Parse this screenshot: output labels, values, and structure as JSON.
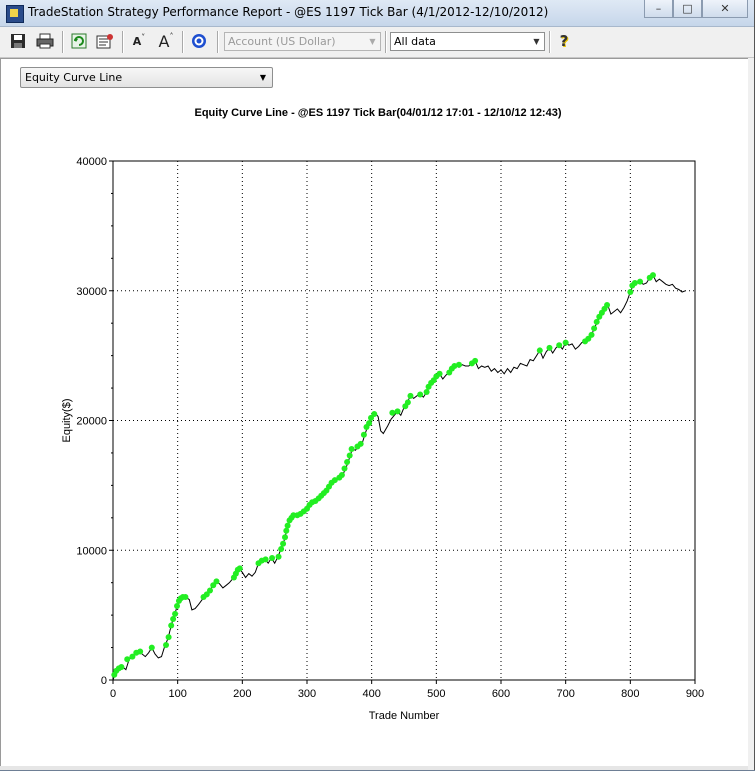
{
  "window": {
    "title": "TradeStation Strategy Performance Report - @ES 1197 Tick Bar (4/1/2012-12/10/2012)",
    "controls": {
      "minimize": "–",
      "maximize": "□",
      "close": "✕"
    }
  },
  "toolbar": {
    "icons": [
      "save-icon",
      "print-icon",
      "refresh-icon",
      "settings-icon",
      "font-decrease-icon",
      "font-increase-icon",
      "target-icon",
      "help-icon"
    ],
    "font_small": "A",
    "font_large": "A",
    "help": "?",
    "account_select": "Account (US Dollar)",
    "range_select": "All data"
  },
  "view_select": {
    "value": "Equity Curve Line"
  },
  "chart_data": {
    "type": "line",
    "title": "Equity Curve Line - @ES 1197 Tick Bar(04/01/12 17:01 - 12/10/12 12:43)",
    "xlabel": "Trade Number",
    "ylabel": "Equity($)",
    "xlim": [
      0,
      900
    ],
    "ylim": [
      0,
      40000
    ],
    "x_ticks": [
      0,
      100,
      200,
      300,
      400,
      500,
      600,
      700,
      800,
      900
    ],
    "y_ticks": [
      0,
      10000,
      20000,
      30000,
      40000
    ],
    "grid": "dotted",
    "colors": {
      "line": "#000000",
      "new_high_marker": "#22ee22"
    },
    "series": [
      {
        "points": [
          [
            0,
            0
          ],
          [
            5,
            700
          ],
          [
            10,
            900
          ],
          [
            15,
            1000
          ],
          [
            20,
            800
          ],
          [
            25,
            1600
          ],
          [
            30,
            1800
          ],
          [
            35,
            2000
          ],
          [
            40,
            2200
          ],
          [
            45,
            2000
          ],
          [
            50,
            1800
          ],
          [
            55,
            2100
          ],
          [
            60,
            2500
          ],
          [
            65,
            2000
          ],
          [
            70,
            1700
          ],
          [
            75,
            1800
          ],
          [
            80,
            2600
          ],
          [
            85,
            3200
          ],
          [
            90,
            4200
          ],
          [
            95,
            5000
          ],
          [
            100,
            5800
          ],
          [
            105,
            6300
          ],
          [
            110,
            6400
          ],
          [
            115,
            6300
          ],
          [
            118,
            6200
          ],
          [
            122,
            5400
          ],
          [
            127,
            5500
          ],
          [
            132,
            5800
          ],
          [
            138,
            6200
          ],
          [
            145,
            6600
          ],
          [
            150,
            6900
          ],
          [
            155,
            7300
          ],
          [
            160,
            7600
          ],
          [
            165,
            7400
          ],
          [
            170,
            7100
          ],
          [
            175,
            7300
          ],
          [
            180,
            7500
          ],
          [
            185,
            7800
          ],
          [
            190,
            8200
          ],
          [
            195,
            8600
          ],
          [
            200,
            8300
          ],
          [
            205,
            7900
          ],
          [
            210,
            8200
          ],
          [
            215,
            8000
          ],
          [
            220,
            8300
          ],
          [
            225,
            9000
          ],
          [
            230,
            9200
          ],
          [
            235,
            9300
          ],
          [
            240,
            9000
          ],
          [
            245,
            9400
          ],
          [
            250,
            9000
          ],
          [
            255,
            9500
          ],
          [
            260,
            10100
          ],
          [
            265,
            10800
          ],
          [
            270,
            11800
          ],
          [
            275,
            12500
          ],
          [
            280,
            12700
          ],
          [
            285,
            12600
          ],
          [
            290,
            12800
          ],
          [
            295,
            13000
          ],
          [
            300,
            13200
          ],
          [
            305,
            13600
          ],
          [
            310,
            13700
          ],
          [
            315,
            13800
          ],
          [
            320,
            14000
          ],
          [
            325,
            14300
          ],
          [
            330,
            14500
          ],
          [
            335,
            14800
          ],
          [
            340,
            15200
          ],
          [
            345,
            15400
          ],
          [
            350,
            15500
          ],
          [
            355,
            15800
          ],
          [
            360,
            16300
          ],
          [
            365,
            17000
          ],
          [
            370,
            17800
          ],
          [
            375,
            17700
          ],
          [
            380,
            18100
          ],
          [
            385,
            18200
          ],
          [
            390,
            19000
          ],
          [
            395,
            19700
          ],
          [
            400,
            20200
          ],
          [
            405,
            20600
          ],
          [
            410,
            20300
          ],
          [
            414,
            19200
          ],
          [
            418,
            19000
          ],
          [
            425,
            19600
          ],
          [
            430,
            20100
          ],
          [
            435,
            20400
          ],
          [
            440,
            20700
          ],
          [
            445,
            20400
          ],
          [
            450,
            21000
          ],
          [
            455,
            21400
          ],
          [
            460,
            21900
          ],
          [
            465,
            21700
          ],
          [
            470,
            21900
          ],
          [
            475,
            22000
          ],
          [
            480,
            21800
          ],
          [
            485,
            22200
          ],
          [
            490,
            22700
          ],
          [
            495,
            23000
          ],
          [
            500,
            23400
          ],
          [
            505,
            23600
          ],
          [
            510,
            23200
          ],
          [
            515,
            23500
          ],
          [
            520,
            23700
          ],
          [
            525,
            24100
          ],
          [
            530,
            24300
          ],
          [
            535,
            24100
          ],
          [
            540,
            24300
          ],
          [
            545,
            24200
          ],
          [
            550,
            24200
          ],
          [
            555,
            24400
          ],
          [
            560,
            24600
          ],
          [
            565,
            24000
          ],
          [
            570,
            24200
          ],
          [
            575,
            24100
          ],
          [
            580,
            24200
          ],
          [
            585,
            23800
          ],
          [
            590,
            24000
          ],
          [
            595,
            23700
          ],
          [
            600,
            23900
          ],
          [
            605,
            23600
          ],
          [
            610,
            24000
          ],
          [
            615,
            23700
          ],
          [
            620,
            24100
          ],
          [
            625,
            24000
          ],
          [
            630,
            24400
          ],
          [
            635,
            24300
          ],
          [
            640,
            24200
          ],
          [
            645,
            24700
          ],
          [
            650,
            24600
          ],
          [
            655,
            25000
          ],
          [
            660,
            25400
          ],
          [
            665,
            24800
          ],
          [
            670,
            25300
          ],
          [
            675,
            25600
          ],
          [
            680,
            25200
          ],
          [
            685,
            25600
          ],
          [
            690,
            25800
          ],
          [
            695,
            25500
          ],
          [
            700,
            26000
          ],
          [
            705,
            25800
          ],
          [
            710,
            25900
          ],
          [
            715,
            25500
          ],
          [
            720,
            25700
          ],
          [
            725,
            26000
          ],
          [
            730,
            26100
          ],
          [
            735,
            26300
          ],
          [
            740,
            26600
          ],
          [
            745,
            27200
          ],
          [
            750,
            27700
          ],
          [
            755,
            28200
          ],
          [
            760,
            28500
          ],
          [
            765,
            28900
          ],
          [
            770,
            28200
          ],
          [
            775,
            28400
          ],
          [
            780,
            28600
          ],
          [
            785,
            28300
          ],
          [
            790,
            28700
          ],
          [
            795,
            29200
          ],
          [
            800,
            29900
          ],
          [
            805,
            30500
          ],
          [
            810,
            30600
          ],
          [
            815,
            30700
          ],
          [
            820,
            30500
          ],
          [
            825,
            30600
          ],
          [
            830,
            31000
          ],
          [
            835,
            31200
          ],
          [
            840,
            30700
          ],
          [
            845,
            30900
          ],
          [
            850,
            30700
          ],
          [
            855,
            30500
          ],
          [
            860,
            30400
          ],
          [
            865,
            30500
          ],
          [
            870,
            30200
          ],
          [
            875,
            30100
          ],
          [
            880,
            29900
          ],
          [
            885,
            30000
          ]
        ],
        "highs": [
          [
            2,
            400
          ],
          [
            5,
            700
          ],
          [
            9,
            900
          ],
          [
            13,
            1000
          ],
          [
            22,
            1600
          ],
          [
            30,
            1800
          ],
          [
            36,
            2100
          ],
          [
            42,
            2200
          ],
          [
            60,
            2500
          ],
          [
            82,
            2700
          ],
          [
            86,
            3300
          ],
          [
            90,
            4200
          ],
          [
            93,
            4700
          ],
          [
            96,
            5100
          ],
          [
            99,
            5700
          ],
          [
            102,
            6100
          ],
          [
            105,
            6300
          ],
          [
            108,
            6400
          ],
          [
            112,
            6400
          ],
          [
            140,
            6400
          ],
          [
            145,
            6600
          ],
          [
            150,
            6900
          ],
          [
            155,
            7300
          ],
          [
            160,
            7600
          ],
          [
            187,
            7900
          ],
          [
            190,
            8200
          ],
          [
            193,
            8500
          ],
          [
            196,
            8600
          ],
          [
            225,
            9000
          ],
          [
            230,
            9200
          ],
          [
            236,
            9300
          ],
          [
            246,
            9400
          ],
          [
            256,
            9500
          ],
          [
            260,
            10100
          ],
          [
            263,
            10500
          ],
          [
            266,
            11000
          ],
          [
            268,
            11500
          ],
          [
            270,
            11900
          ],
          [
            273,
            12300
          ],
          [
            276,
            12500
          ],
          [
            279,
            12700
          ],
          [
            285,
            12700
          ],
          [
            290,
            12800
          ],
          [
            295,
            13000
          ],
          [
            300,
            13200
          ],
          [
            304,
            13500
          ],
          [
            308,
            13700
          ],
          [
            313,
            13800
          ],
          [
            318,
            14000
          ],
          [
            322,
            14200
          ],
          [
            326,
            14400
          ],
          [
            330,
            14600
          ],
          [
            334,
            14900
          ],
          [
            338,
            15200
          ],
          [
            343,
            15400
          ],
          [
            350,
            15600
          ],
          [
            354,
            15800
          ],
          [
            358,
            16300
          ],
          [
            362,
            16800
          ],
          [
            366,
            17300
          ],
          [
            369,
            17800
          ],
          [
            378,
            18000
          ],
          [
            383,
            18200
          ],
          [
            388,
            18900
          ],
          [
            392,
            19500
          ],
          [
            396,
            19800
          ],
          [
            399,
            20200
          ],
          [
            404,
            20500
          ],
          [
            432,
            20600
          ],
          [
            440,
            20700
          ],
          [
            452,
            21100
          ],
          [
            456,
            21400
          ],
          [
            460,
            21900
          ],
          [
            475,
            22000
          ],
          [
            485,
            22200
          ],
          [
            488,
            22600
          ],
          [
            492,
            22900
          ],
          [
            496,
            23100
          ],
          [
            500,
            23400
          ],
          [
            505,
            23600
          ],
          [
            520,
            23700
          ],
          [
            524,
            24000
          ],
          [
            528,
            24200
          ],
          [
            535,
            24300
          ],
          [
            555,
            24400
          ],
          [
            560,
            24600
          ],
          [
            660,
            25400
          ],
          [
            675,
            25600
          ],
          [
            690,
            25800
          ],
          [
            700,
            26000
          ],
          [
            730,
            26100
          ],
          [
            735,
            26300
          ],
          [
            740,
            26600
          ],
          [
            744,
            27100
          ],
          [
            748,
            27600
          ],
          [
            752,
            28000
          ],
          [
            756,
            28300
          ],
          [
            760,
            28600
          ],
          [
            764,
            28900
          ],
          [
            800,
            29900
          ],
          [
            803,
            30400
          ],
          [
            807,
            30600
          ],
          [
            815,
            30700
          ],
          [
            830,
            31000
          ],
          [
            835,
            31200
          ]
        ]
      }
    ]
  }
}
